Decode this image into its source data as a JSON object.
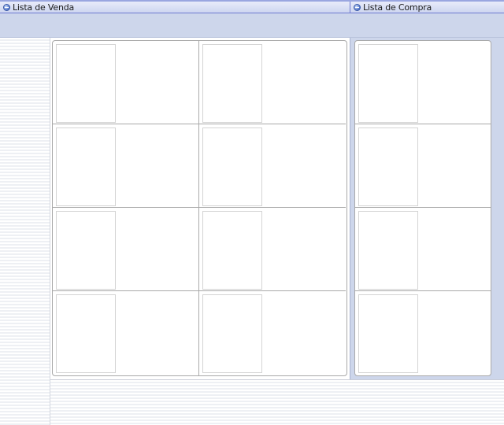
{
  "tabs": {
    "sell": {
      "label": "Lista de Venda",
      "icon": "globe-icon"
    },
    "buy": {
      "label": "Lista de Compra",
      "icon": "globe-icon"
    }
  },
  "colors": {
    "header_border": "#6f7bd0",
    "panel_band": "#cdd6eb",
    "grid_line": "#a9a9a9",
    "slot_border": "#d4d4d4"
  },
  "sell_list": {
    "columns": 2,
    "rows": 4,
    "slots_filled": 0
  },
  "buy_list": {
    "columns": 1,
    "rows": 4,
    "slots_filled": 0
  }
}
